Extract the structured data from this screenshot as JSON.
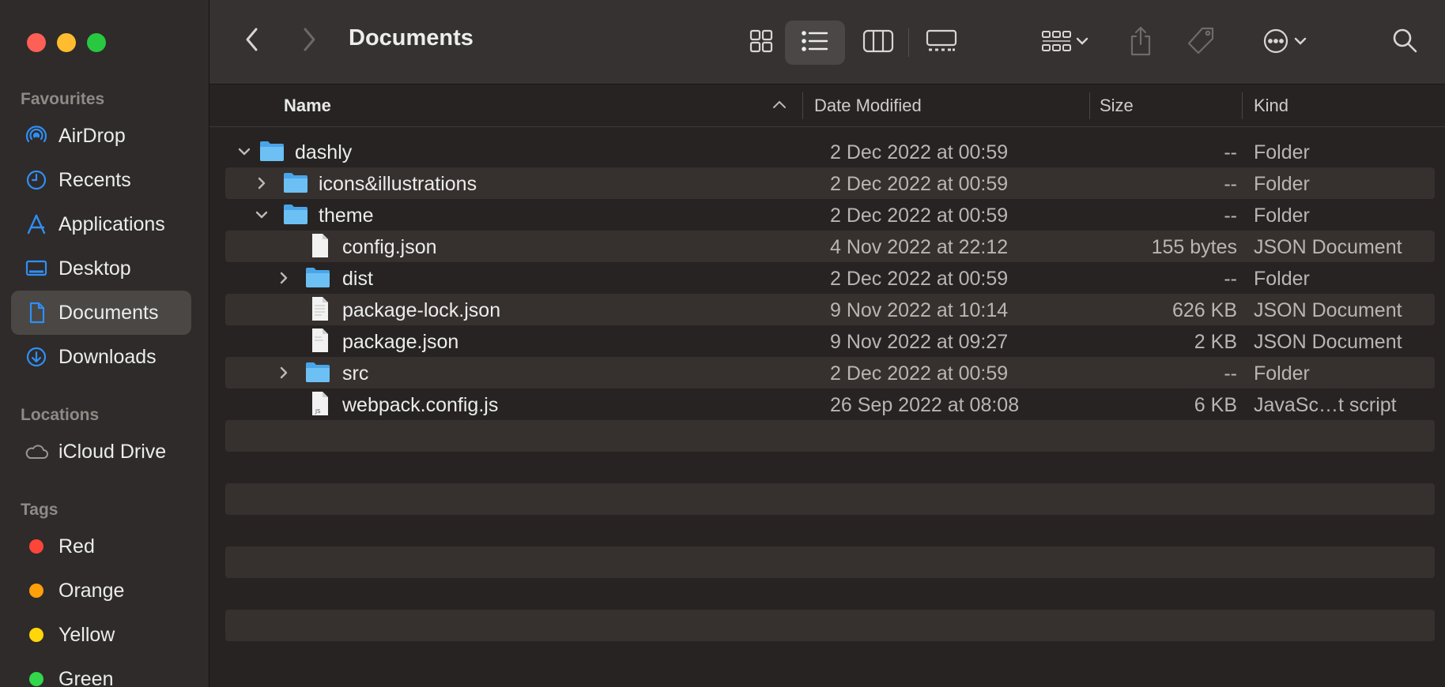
{
  "window": {
    "title": "Documents"
  },
  "sidebar": {
    "favourites_title": "Favourites",
    "favourites": [
      {
        "label": "AirDrop",
        "icon": "airdrop-icon"
      },
      {
        "label": "Recents",
        "icon": "clock-icon"
      },
      {
        "label": "Applications",
        "icon": "applications-icon"
      },
      {
        "label": "Desktop",
        "icon": "desktop-icon"
      },
      {
        "label": "Documents",
        "icon": "document-icon",
        "selected": true
      },
      {
        "label": "Downloads",
        "icon": "download-icon"
      }
    ],
    "locations_title": "Locations",
    "locations": [
      {
        "label": "iCloud Drive",
        "icon": "cloud-icon"
      }
    ],
    "tags_title": "Tags",
    "tags": [
      {
        "label": "Red",
        "color": "#ff453a"
      },
      {
        "label": "Orange",
        "color": "#ff9f0a"
      },
      {
        "label": "Yellow",
        "color": "#ffd60a"
      },
      {
        "label": "Green",
        "color": "#32d74b"
      }
    ]
  },
  "columns": {
    "name": "Name",
    "date": "Date Modified",
    "size": "Size",
    "kind": "Kind"
  },
  "files": [
    {
      "name": "dashly",
      "date": "2 Dec 2022 at 00:59",
      "size": "--",
      "kind": "Folder",
      "type": "folder",
      "level": 0,
      "expanded": true
    },
    {
      "name": "icons&illustrations",
      "date": "2 Dec 2022 at 00:59",
      "size": "--",
      "kind": "Folder",
      "type": "folder",
      "level": 1,
      "expanded": false
    },
    {
      "name": "theme",
      "date": "2 Dec 2022 at 00:59",
      "size": "--",
      "kind": "Folder",
      "type": "folder",
      "level": 1,
      "expanded": true
    },
    {
      "name": "config.json",
      "date": "4 Nov 2022 at 22:12",
      "size": "155 bytes",
      "kind": "JSON Document",
      "type": "file",
      "level": 2
    },
    {
      "name": "dist",
      "date": "2 Dec 2022 at 00:59",
      "size": "--",
      "kind": "Folder",
      "type": "folder",
      "level": 2,
      "expanded": false
    },
    {
      "name": "package-lock.json",
      "date": "9 Nov 2022 at 10:14",
      "size": "626 KB",
      "kind": "JSON Document",
      "type": "file",
      "level": 2
    },
    {
      "name": "package.json",
      "date": "9 Nov 2022 at 09:27",
      "size": "2 KB",
      "kind": "JSON Document",
      "type": "file",
      "level": 2
    },
    {
      "name": "src",
      "date": "2 Dec 2022 at 00:59",
      "size": "--",
      "kind": "Folder",
      "type": "folder",
      "level": 2,
      "expanded": false
    },
    {
      "name": "webpack.config.js",
      "date": "26 Sep 2022 at 08:08",
      "size": "6 KB",
      "kind": "JavaSc…t script",
      "type": "js",
      "js_badge": "JS",
      "level": 2
    }
  ],
  "colors": {
    "accent": "#2f8ff6",
    "folder": "#5ab4f0"
  }
}
